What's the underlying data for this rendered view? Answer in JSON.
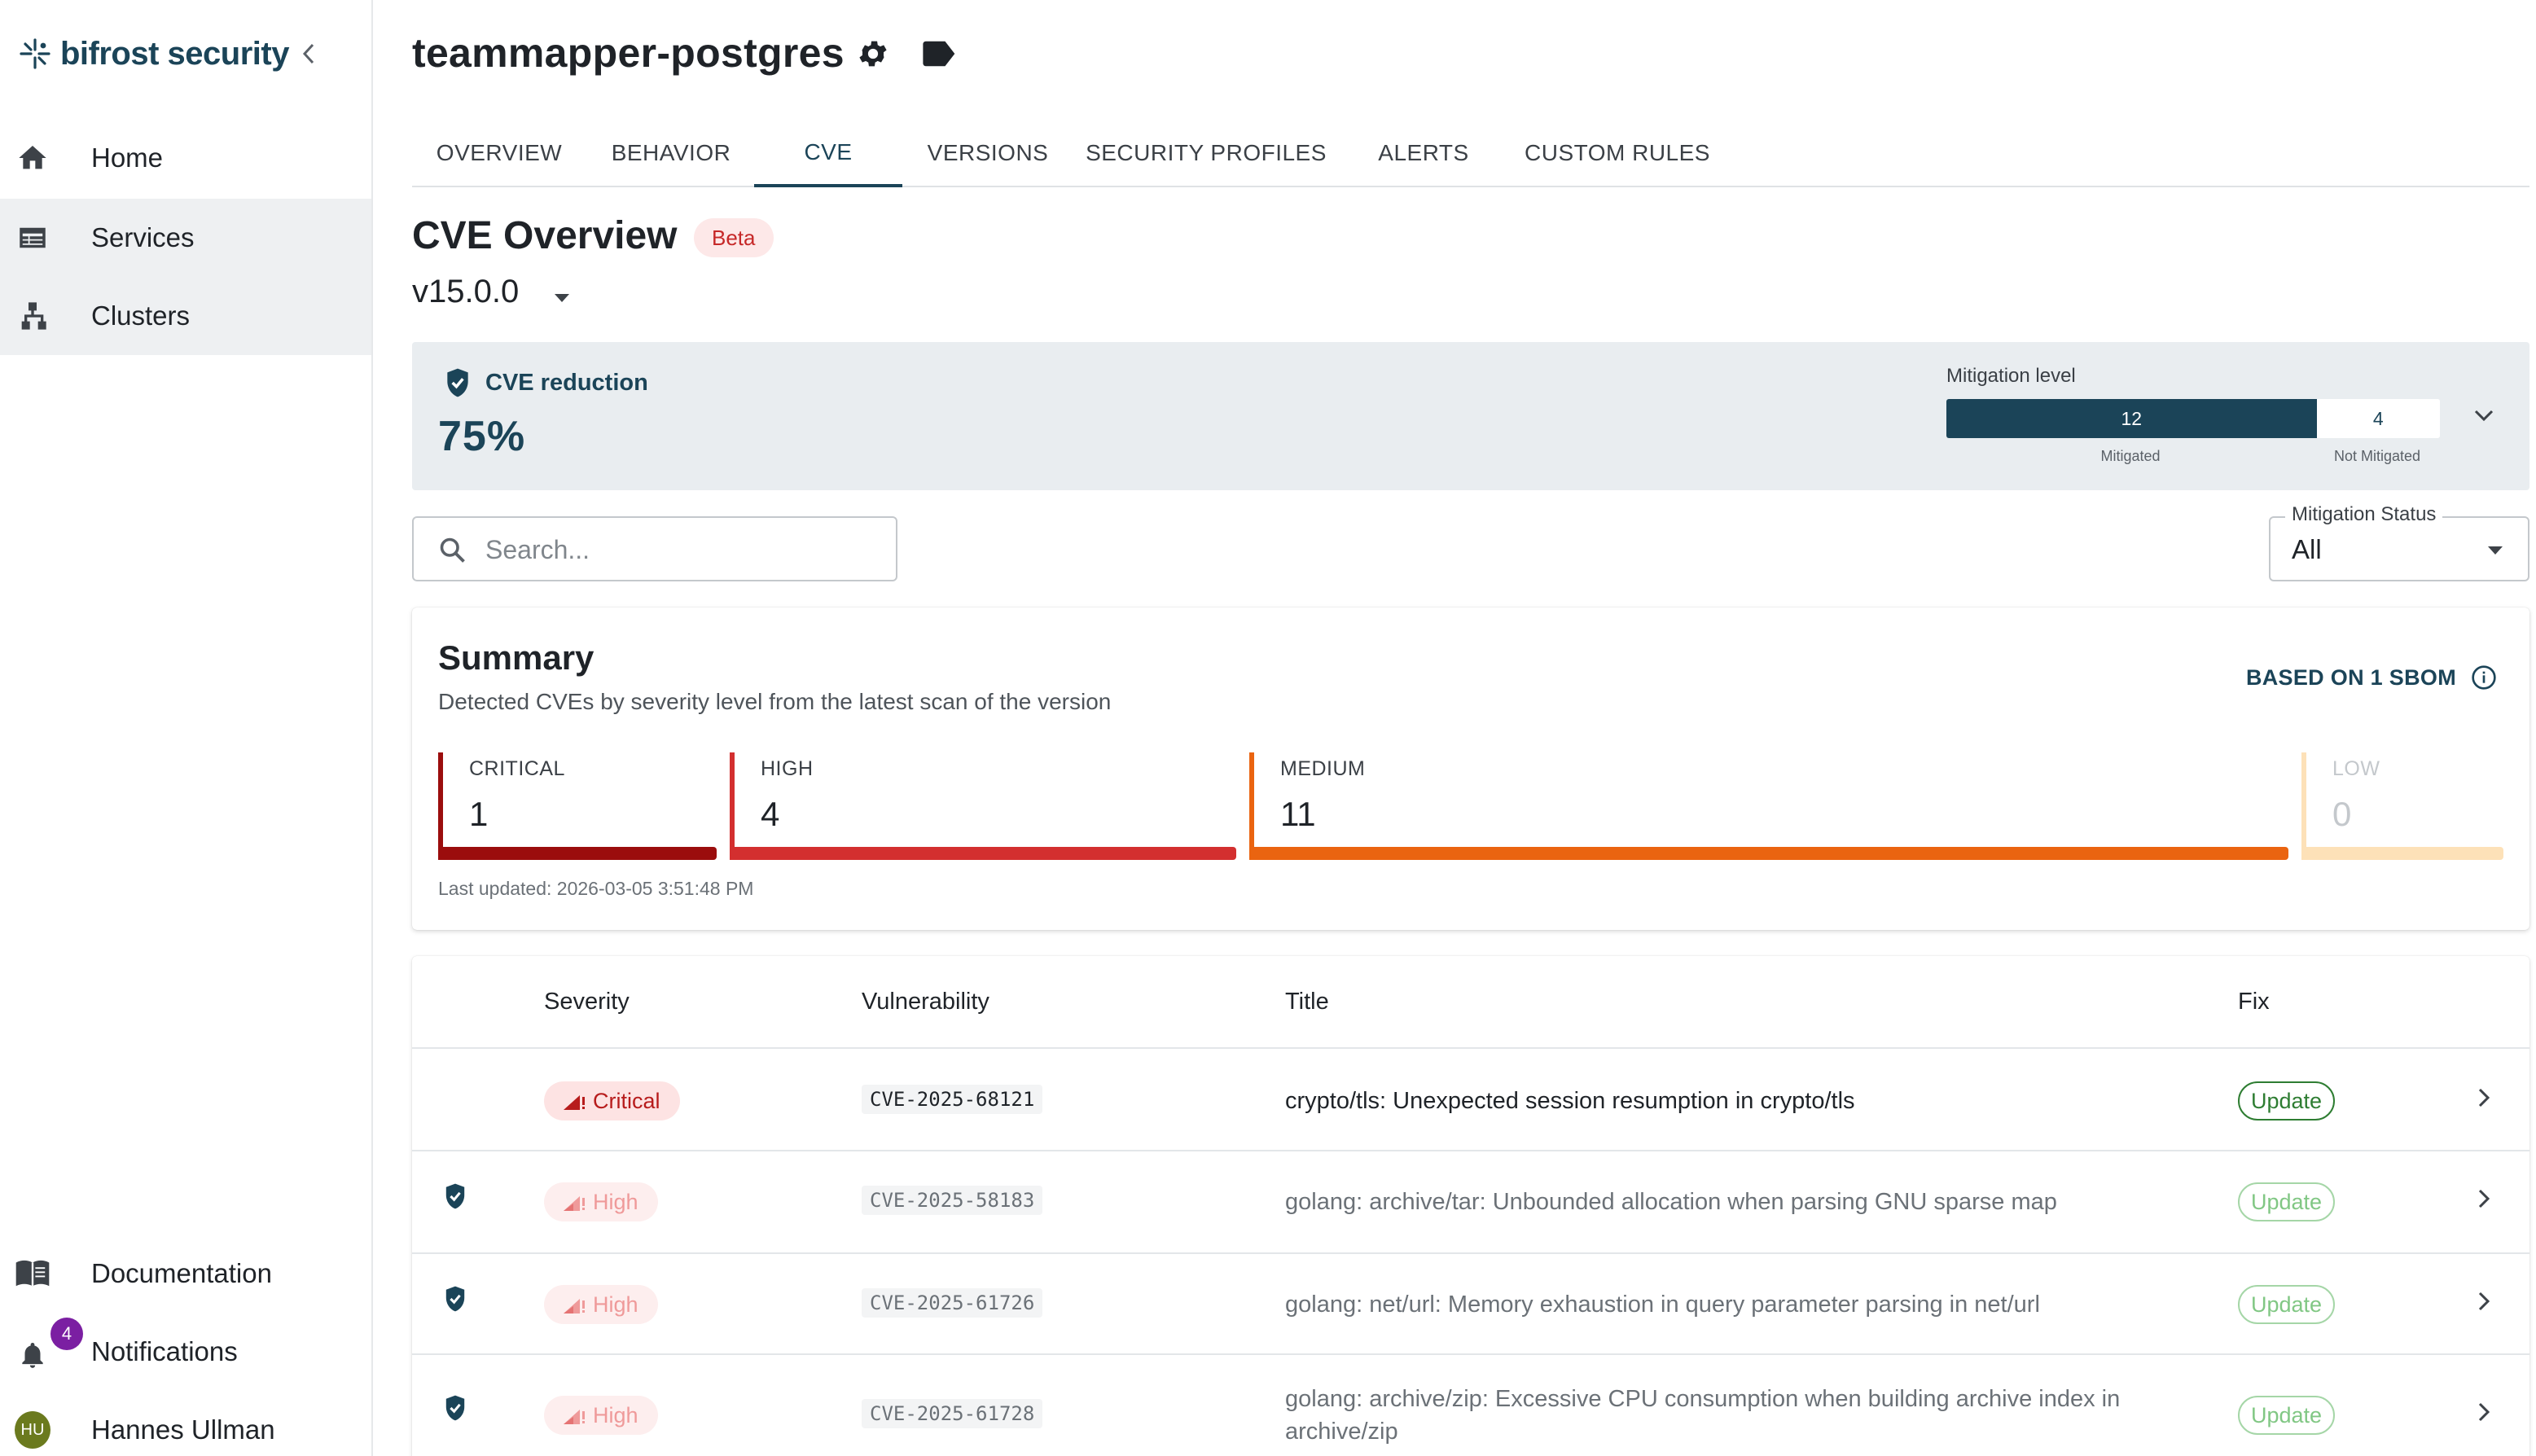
{
  "sidebar": {
    "brand": "bifrost security",
    "items": [
      {
        "label": "Home",
        "icon": "home-icon"
      },
      {
        "label": "Services",
        "icon": "services-icon",
        "active": true
      },
      {
        "label": "Clusters",
        "icon": "clusters-icon"
      }
    ],
    "footer": {
      "documentation": "Documentation",
      "notifications": "Notifications",
      "notifications_count": "4",
      "user_name": "Hannes Ullman",
      "user_initials": "HU"
    }
  },
  "header": {
    "title": "teammapper-postgres"
  },
  "tabs": [
    "OVERVIEW",
    "BEHAVIOR",
    "CVE",
    "VERSIONS",
    "SECURITY PROFILES",
    "ALERTS",
    "CUSTOM RULES"
  ],
  "active_tab": "CVE",
  "cve": {
    "title": "CVE Overview",
    "badge": "Beta",
    "version": "v15.0.0",
    "reduction": {
      "label": "CVE reduction",
      "value": "75%",
      "mitigation_label": "Mitigation level",
      "mitigated": "12",
      "not_mitigated": "4",
      "mitigated_fraction": 0.75,
      "mitigated_caption": "Mitigated",
      "not_mitigated_caption": "Not Mitigated"
    },
    "search_placeholder": "Search...",
    "filter": {
      "label": "Mitigation Status",
      "value": "All"
    }
  },
  "summary": {
    "title": "Summary",
    "subtitle": "Detected CVEs by severity level from the latest scan of the version",
    "sbom": "BASED ON 1 SBOM",
    "levels": [
      {
        "label": "CRITICAL",
        "count": "1"
      },
      {
        "label": "HIGH",
        "count": "4"
      },
      {
        "label": "MEDIUM",
        "count": "11"
      },
      {
        "label": "LOW",
        "count": "0"
      }
    ],
    "colors": {
      "critical": "#9b0d0d",
      "high": "#d32f2f",
      "medium": "#ea6410",
      "low": "#fde1b8"
    },
    "last_updated": "Last updated: 2026-03-05 3:51:48 PM"
  },
  "table": {
    "headers": {
      "severity": "Severity",
      "vulnerability": "Vulnerability",
      "title": "Title",
      "fix": "Fix"
    },
    "rows": [
      {
        "severity": "Critical",
        "id": "CVE-2025-68121",
        "title": "crypto/tls: Unexpected session resumption in crypto/tls",
        "fix": "Update",
        "mitigated": false
      },
      {
        "severity": "High",
        "id": "CVE-2025-58183",
        "title": "golang: archive/tar: Unbounded allocation when parsing GNU sparse map",
        "fix": "Update",
        "mitigated": true
      },
      {
        "severity": "High",
        "id": "CVE-2025-61726",
        "title": "golang: net/url: Memory exhaustion in query parameter parsing in net/url",
        "fix": "Update",
        "mitigated": true
      },
      {
        "severity": "High",
        "id": "CVE-2025-61728",
        "title": "golang: archive/zip: Excessive CPU consumption when building archive index in archive/zip",
        "fix": "Update",
        "mitigated": true
      }
    ]
  }
}
